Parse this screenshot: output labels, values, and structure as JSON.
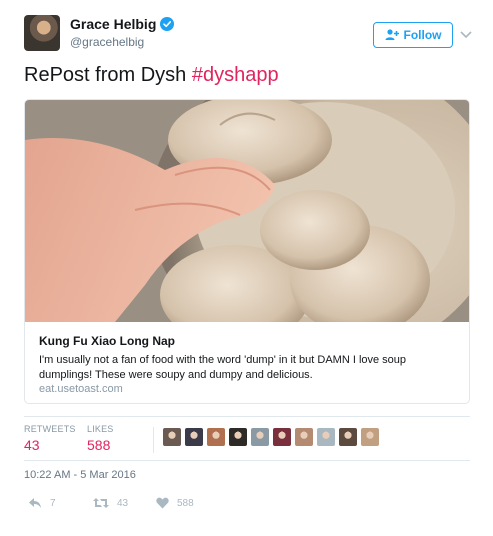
{
  "user": {
    "display_name": "Grace Helbig",
    "handle": "@gracehelbig"
  },
  "follow_button": {
    "label": "Follow"
  },
  "tweet": {
    "text": "RePost from Dysh ",
    "hashtag": "#dyshapp"
  },
  "card": {
    "title": "Kung Fu Xiao Long Nap",
    "description": "I'm usually not a fan of food with the word 'dump' in it but DAMN I love soup dumplings! These were soupy and dumpy and delicious.",
    "url": "eat.usetoast.com"
  },
  "stats": {
    "retweets_label": "RETWEETS",
    "retweets": "43",
    "likes_label": "LIKES",
    "likes": "588",
    "liker_colors": [
      "#6a5a52",
      "#3a3a4a",
      "#b07050",
      "#2d2a28",
      "#8a9aa5",
      "#7a2f3c",
      "#b48a70",
      "#a9b8c0",
      "#5c4a3f",
      "#c0a080"
    ]
  },
  "timestamp": "10:22 AM - 5 Mar 2016",
  "actions": {
    "reply_count": "7",
    "retweet_count": "43",
    "like_count": "588"
  },
  "colors": {
    "accent": "#1da1f2",
    "hashtag": "#e0245e",
    "stat_value": "#e0245e",
    "muted": "#8899a6"
  }
}
